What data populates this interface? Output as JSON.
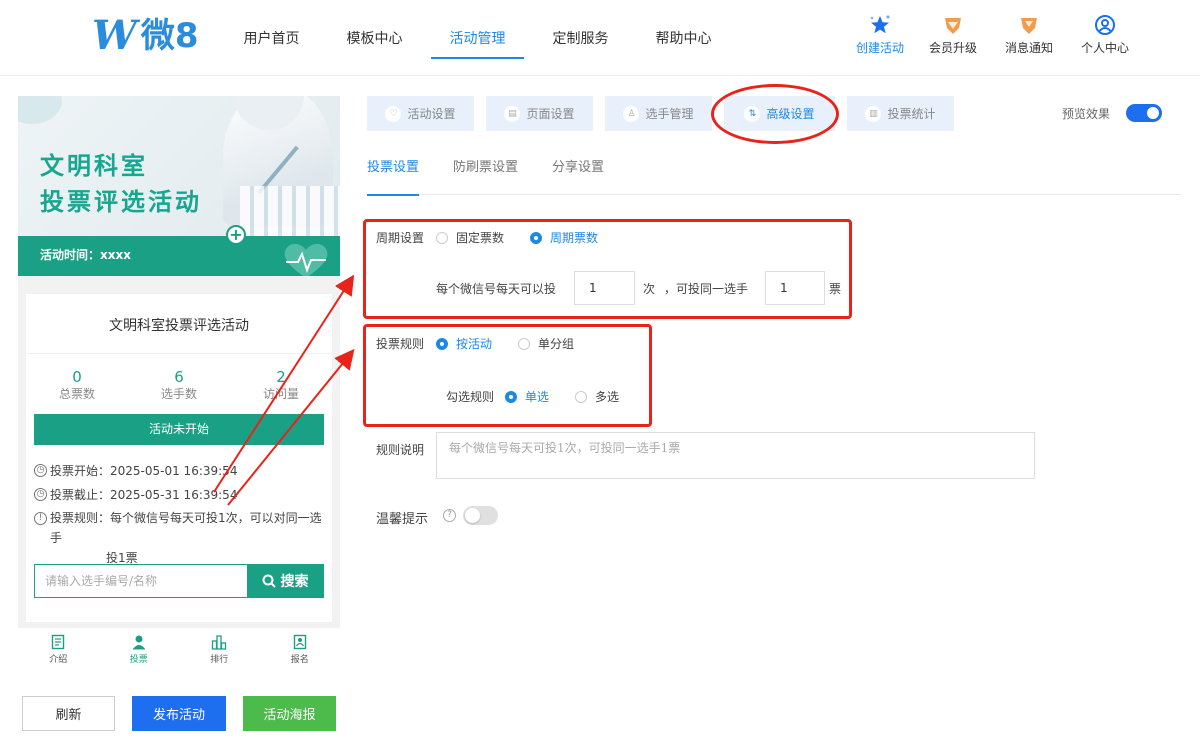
{
  "header": {
    "logo_text": "微8",
    "nav": [
      "用户首页",
      "模板中心",
      "活动管理",
      "定制服务",
      "帮助中心"
    ],
    "active_nav": "活动管理",
    "tools": {
      "create": "创建活动",
      "upgrade": "会员升级",
      "notify": "消息通知",
      "profile": "个人中心"
    }
  },
  "preview": {
    "banner_title_1": "文明科室",
    "banner_title_2": "投票评选活动",
    "banner_time": "活动时间：xxxx",
    "card_title": "文明科室投票评选活动",
    "stats": [
      {
        "value": "0",
        "label": "总票数"
      },
      {
        "value": "6",
        "label": "选手数"
      },
      {
        "value": "2",
        "label": "访问量"
      }
    ],
    "status_button": "活动未开始",
    "vote_start": "投票开始：2025-05-01 16:39:54",
    "vote_end": "投票截止：2025-05-31 16:39:54",
    "vote_rule_a": "投票规则：每个微信号每天可投1次，可以对同一选手",
    "vote_rule_b": "投1票",
    "search_placeholder": "请输入选手编号/名称",
    "search_button": "搜索",
    "tabs": [
      "介绍",
      "投票",
      "排行",
      "报名"
    ],
    "active_tab": "投票"
  },
  "actions": {
    "refresh": "刷新",
    "publish": "发布活动",
    "poster": "活动海报"
  },
  "settings": {
    "top_tabs": [
      "活动设置",
      "页面设置",
      "选手管理",
      "高级设置",
      "投票统计"
    ],
    "active_top_tab": "高级设置",
    "preview_label": "预览效果",
    "sub_tabs": [
      "投票设置",
      "防刷票设置",
      "分享设置"
    ],
    "active_sub_tab": "投票设置",
    "cycle": {
      "label": "周期设置",
      "option_fixed": "固定票数",
      "option_cycle": "周期票数",
      "per_day_prefix": "每个微信号每天可以投",
      "per_day_value": "1",
      "times_unit": "次",
      "same_player": "，可投同一选手",
      "same_value": "1",
      "votes_unit": "票"
    },
    "rule": {
      "label": "投票规则",
      "option_activity": "按活动",
      "option_group": "单分组",
      "select_label": "勾选规则",
      "option_single": "单选",
      "option_multi": "多选"
    },
    "desc": {
      "label": "规则说明",
      "placeholder": "每个微信号每天可投1次，可投同一选手1票"
    },
    "tip_label": "温馨提示",
    "help_icon_text": "?"
  },
  "colors": {
    "brand_blue": "#1e88e5",
    "green": "#1aa085",
    "annotation_red": "#e8231a"
  }
}
